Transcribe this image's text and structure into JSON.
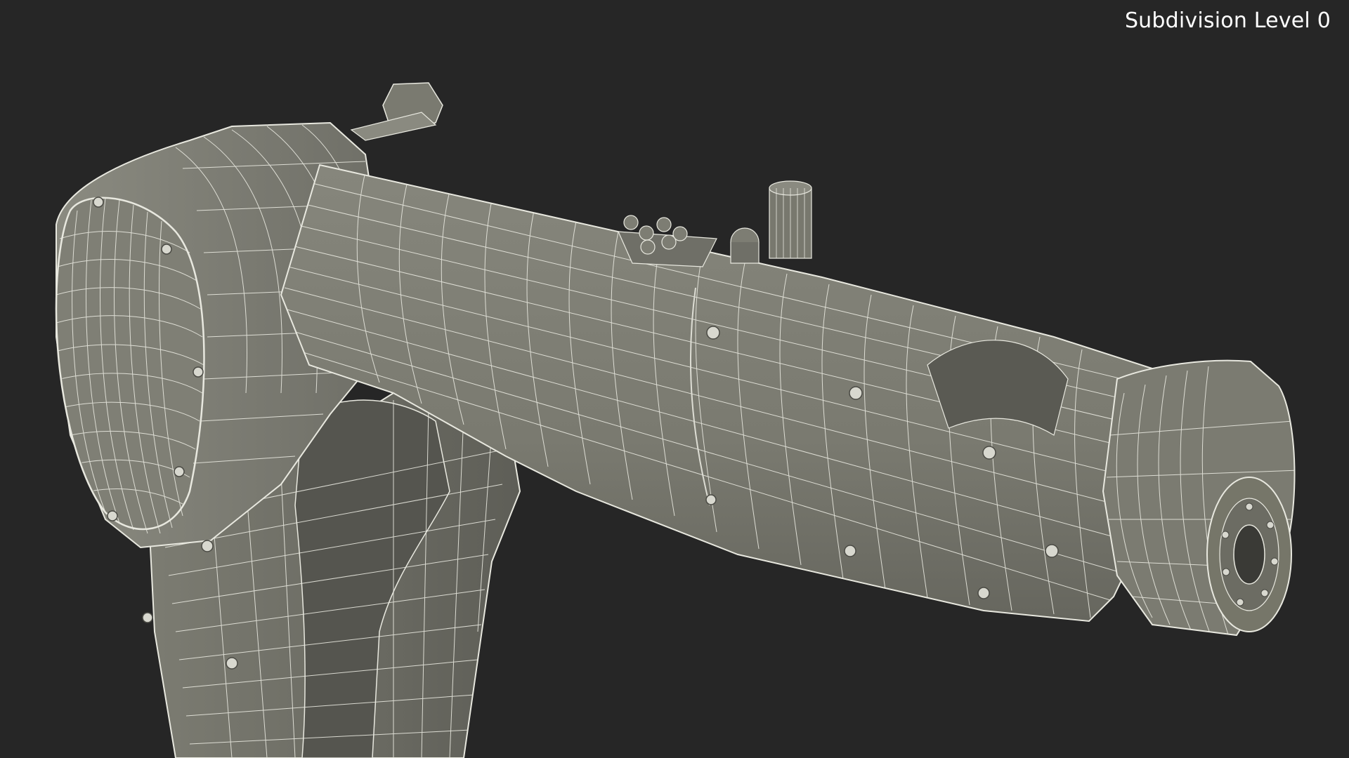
{
  "viewport": {
    "background_color": "#262626",
    "subdivision_label": "Subdivision Level 0"
  },
  "model": {
    "subject": "robot-arm",
    "surface_color": "#7b7b71",
    "surface_shadow_color": "#5f5f57",
    "wire_color": "#e8e8df"
  }
}
